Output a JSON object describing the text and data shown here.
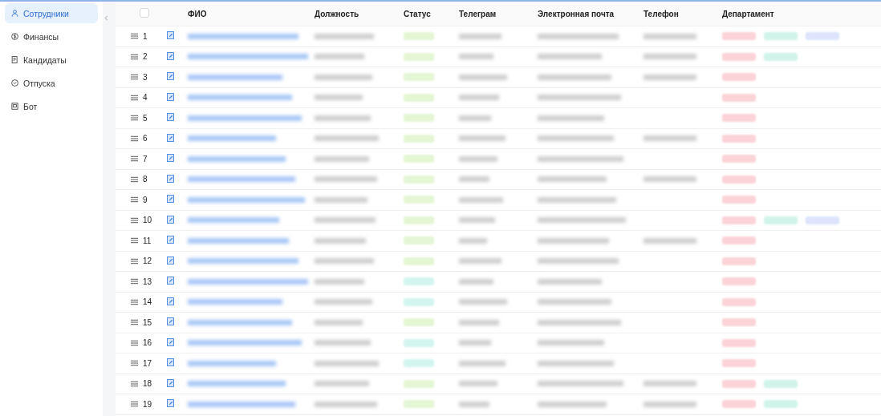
{
  "sidebar": {
    "items": [
      {
        "label": "Сотрудники",
        "kind": "user",
        "selected": true
      },
      {
        "label": "Финансы",
        "kind": "dollar",
        "selected": false
      },
      {
        "label": "Кандидаты",
        "kind": "doc",
        "selected": false
      },
      {
        "label": "Отпуска",
        "kind": "check",
        "selected": false
      },
      {
        "label": "Бот",
        "kind": "bot",
        "selected": false
      }
    ]
  },
  "table": {
    "select_all": {
      "checked": false
    },
    "columns": [
      "ФИО",
      "Должность",
      "Статус",
      "Телеграм",
      "Электронная почта",
      "Телефон",
      "Департамент"
    ],
    "rows": [
      {
        "number": "1",
        "status": {
          "color": "#e4f6d4"
        },
        "phone": true,
        "departments": [
          {
            "color": "#fbd3d8"
          },
          {
            "color": "#d0f3ea"
          },
          {
            "color": "#dde4fb"
          }
        ]
      },
      {
        "number": "2",
        "status": {
          "color": "#e4f6d4"
        },
        "phone": true,
        "departments": [
          {
            "color": "#fbd3d8"
          },
          {
            "color": "#d0f3ea"
          }
        ]
      },
      {
        "number": "3",
        "status": {
          "color": "#e4f6d4"
        },
        "phone": true,
        "departments": [
          {
            "color": "#fbd3d8"
          }
        ]
      },
      {
        "number": "4",
        "status": {
          "color": "#e4f6d4"
        },
        "phone": false,
        "departments": [
          {
            "color": "#fbd3d8"
          }
        ]
      },
      {
        "number": "5",
        "status": {
          "color": "#e4f6d4"
        },
        "phone": false,
        "departments": [
          {
            "color": "#fbd3d8"
          }
        ]
      },
      {
        "number": "6",
        "status": {
          "color": "#e4f6d4"
        },
        "phone": true,
        "departments": [
          {
            "color": "#fbd3d8"
          }
        ]
      },
      {
        "number": "7",
        "status": {
          "color": "#e4f6d4"
        },
        "phone": false,
        "departments": [
          {
            "color": "#fbd3d8"
          }
        ]
      },
      {
        "number": "8",
        "status": {
          "color": "#e4f6d4"
        },
        "phone": true,
        "departments": [
          {
            "color": "#fbd3d8"
          }
        ]
      },
      {
        "number": "9",
        "status": {
          "color": "#e4f6d4"
        },
        "phone": false,
        "departments": [
          {
            "color": "#fbd3d8"
          }
        ]
      },
      {
        "number": "10",
        "status": {
          "color": "#e4f6d4"
        },
        "phone": false,
        "departments": [
          {
            "color": "#fbd3d8"
          },
          {
            "color": "#d0f3ea"
          },
          {
            "color": "#dde4fb"
          }
        ]
      },
      {
        "number": "11",
        "status": {
          "color": "#e4f6d4"
        },
        "phone": true,
        "departments": [
          {
            "color": "#fbd3d8"
          }
        ]
      },
      {
        "number": "12",
        "status": {
          "color": "#e4f6d4"
        },
        "phone": false,
        "departments": [
          {
            "color": "#fbd3d8"
          }
        ]
      },
      {
        "number": "13",
        "status": {
          "color": "#d3f5ef"
        },
        "phone": false,
        "departments": [
          {
            "color": "#fbd3d8"
          }
        ]
      },
      {
        "number": "14",
        "status": {
          "color": "#d3f5ef"
        },
        "phone": false,
        "departments": [
          {
            "color": "#fbd3d8"
          }
        ]
      },
      {
        "number": "15",
        "status": {
          "color": "#e4f6d4"
        },
        "phone": false,
        "departments": [
          {
            "color": "#fbd3d8"
          }
        ]
      },
      {
        "number": "16",
        "status": {
          "color": "#d3f5ef"
        },
        "phone": false,
        "departments": [
          {
            "color": "#fbd3d8"
          }
        ]
      },
      {
        "number": "17",
        "status": {
          "color": "#d3f5ef"
        },
        "phone": false,
        "departments": [
          {
            "color": "#fbd3d8"
          }
        ]
      },
      {
        "number": "18",
        "status": {
          "color": "#e4f6d4"
        },
        "phone": true,
        "departments": [
          {
            "color": "#fbd3d8"
          },
          {
            "color": "#d0f3ea"
          }
        ]
      },
      {
        "number": "19",
        "status": {
          "color": "#e4f6d4"
        },
        "phone": true,
        "departments": [
          {
            "color": "#fbd3d8"
          },
          {
            "color": "#d0f3ea"
          }
        ]
      }
    ]
  }
}
